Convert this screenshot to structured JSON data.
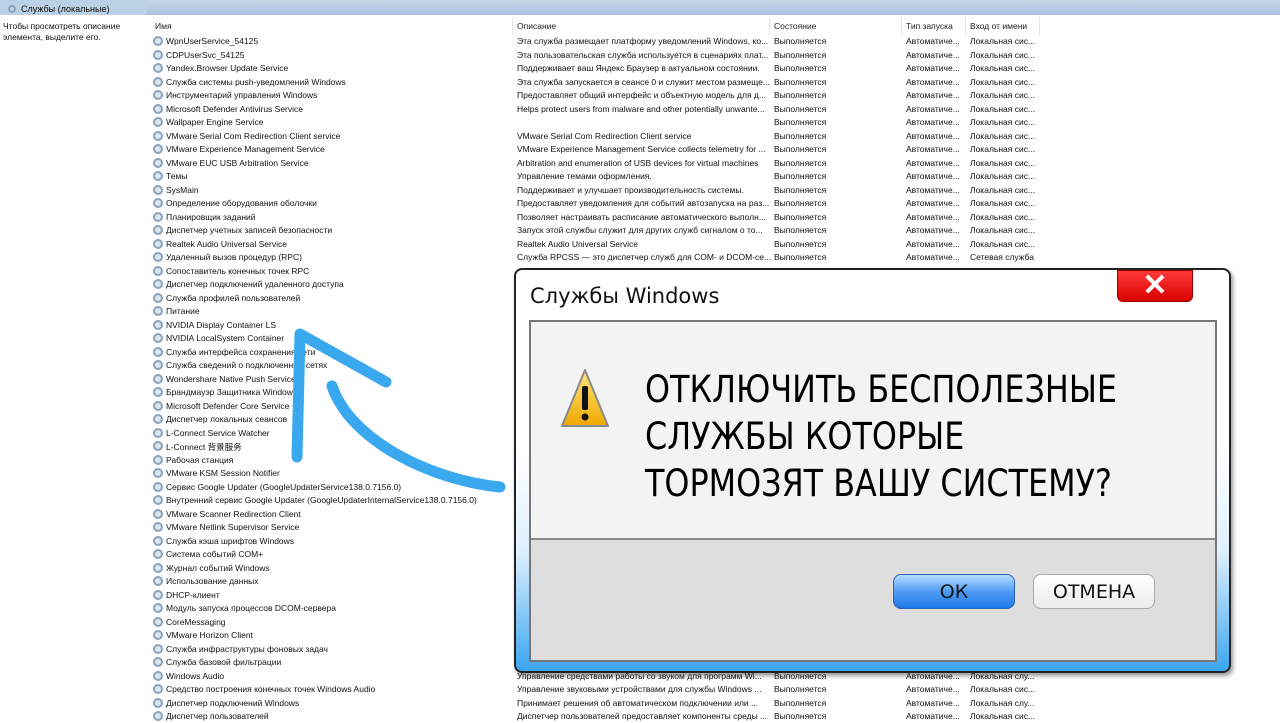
{
  "window": {
    "title": "Службы (локальные)"
  },
  "left_pane": {
    "hint": "Чтобы просмотреть описание элемента, выделите его."
  },
  "columns": {
    "name": "Имя",
    "description": "Описание",
    "state": "Состояние",
    "startup": "Тип запуска",
    "logon": "Вход от имени"
  },
  "rows": [
    {
      "name": "WpnUserService_54125",
      "desc": "Эта служба размещает платформу уведомлений Windows, ко...",
      "state": "Выполняется",
      "startup": "Автоматиче...",
      "logon": "Локальная сис..."
    },
    {
      "name": "CDPUserSvc_54125",
      "desc": "Эта пользовательская служба используется в сценариях плат...",
      "state": "Выполняется",
      "startup": "Автоматиче...",
      "logon": "Локальная сис..."
    },
    {
      "name": "Yandex.Browser Update Service",
      "desc": "Поддерживает ваш Яндекс Браузер в актуальном состоянии.",
      "state": "Выполняется",
      "startup": "Автоматиче...",
      "logon": "Локальная сис..."
    },
    {
      "name": "Служба системы push-уведомлений Windows",
      "desc": "Эта служба запускается в сеансе 0 и служит местом размеще...",
      "state": "Выполняется",
      "startup": "Автоматиче...",
      "logon": "Локальная сис..."
    },
    {
      "name": "Инструментарий управления Windows",
      "desc": "Предоставляет общий интерфейс и объектную модель для д...",
      "state": "Выполняется",
      "startup": "Автоматиче...",
      "logon": "Локальная сис..."
    },
    {
      "name": "Microsoft Defender Antivirus Service",
      "desc": "Helps protect users from malware and other potentially unwante...",
      "state": "Выполняется",
      "startup": "Автоматиче...",
      "logon": "Локальная сис..."
    },
    {
      "name": "Wallpaper Engine Service",
      "desc": "",
      "state": "Выполняется",
      "startup": "Автоматиче...",
      "logon": "Локальная сис..."
    },
    {
      "name": "VMware Serial Com Redirection Client service",
      "desc": "VMware Serial Com Redirection Client service",
      "state": "Выполняется",
      "startup": "Автоматиче...",
      "logon": "Локальная сис..."
    },
    {
      "name": "VMware Experience Management Service",
      "desc": "VMware Experience Management Service collects telemetry for ...",
      "state": "Выполняется",
      "startup": "Автоматиче...",
      "logon": "Локальная сис..."
    },
    {
      "name": "VMware EUC USB Arbitration Service",
      "desc": "Arbitration and enumeration of USB devices for virtual machines",
      "state": "Выполняется",
      "startup": "Автоматиче...",
      "logon": "Локальная сис..."
    },
    {
      "name": "Темы",
      "desc": "Управление темами оформления.",
      "state": "Выполняется",
      "startup": "Автоматиче...",
      "logon": "Локальная сис..."
    },
    {
      "name": "SysMain",
      "desc": "Поддерживает и улучшает производительность системы.",
      "state": "Выполняется",
      "startup": "Автоматиче...",
      "logon": "Локальная сис..."
    },
    {
      "name": "Определение оборудования оболочки",
      "desc": "Предоставляет уведомления для событий автозапуска на раз...",
      "state": "Выполняется",
      "startup": "Автоматиче...",
      "logon": "Локальная сис..."
    },
    {
      "name": "Планировщик заданий",
      "desc": "Позволяет настраивать расписание автоматического выполн...",
      "state": "Выполняется",
      "startup": "Автоматиче...",
      "logon": "Локальная сис..."
    },
    {
      "name": "Диспетчер учетных записей безопасности",
      "desc": "Запуск этой службы служит для других служб сигналом о то...",
      "state": "Выполняется",
      "startup": "Автоматиче...",
      "logon": "Локальная сис..."
    },
    {
      "name": "Realtek Audio Universal Service",
      "desc": "Realtek Audio Universal Service",
      "state": "Выполняется",
      "startup": "Автоматиче...",
      "logon": "Локальная сис..."
    },
    {
      "name": "Удаленный вызов процедур (RPC)",
      "desc": "Служба RPCSS — это диспетчер служб для COM- и DCOM-се...",
      "state": "Выполняется",
      "startup": "Автоматиче...",
      "logon": "Сетевая служба"
    },
    {
      "name": "Сопоставитель конечных точек RPC"
    },
    {
      "name": "Диспетчер подключений удаленного доступа"
    },
    {
      "name": "Служба профилей пользователей"
    },
    {
      "name": "Питание"
    },
    {
      "name": "NVIDIA Display Container LS"
    },
    {
      "name": "NVIDIA LocalSystem Container"
    },
    {
      "name": "Служба интерфейса сохранения сети"
    },
    {
      "name": "Служба сведений о подключенных сетях"
    },
    {
      "name": "Wondershare Native Push Service"
    },
    {
      "name": "Брандмауэр Защитника Windows"
    },
    {
      "name": "Microsoft Defender Core Service"
    },
    {
      "name": "Диспетчер локальных сеансов"
    },
    {
      "name": "L-Connect Service Watcher"
    },
    {
      "name": "L-Connect 背景服务"
    },
    {
      "name": "Рабочая станция"
    },
    {
      "name": "VMware KSM Session Notifier"
    },
    {
      "name": "Сервис Google Updater (GoogleUpdaterService138.0.7156.0)"
    },
    {
      "name": "Внутренний сервис Google Updater (GoogleUpdaterInternalService138.0.7156.0)"
    },
    {
      "name": "VMware Scanner Redirection Client"
    },
    {
      "name": "VMware Netlink Supervisor Service"
    },
    {
      "name": "Служба кэша шрифтов Windows"
    },
    {
      "name": "Система событий COM+"
    },
    {
      "name": "Журнал событий Windows"
    },
    {
      "name": "Использование данных"
    },
    {
      "name": "DHCP-клиент"
    },
    {
      "name": "Модуль запуска процессов DCOM-сервера"
    },
    {
      "name": "CoreMessaging"
    },
    {
      "name": "VMware Horizon Client"
    },
    {
      "name": "Служба инфраструктуры фоновых задач"
    },
    {
      "name": "Служба базовой фильтрации"
    },
    {
      "name": "Windows Audio",
      "desc": "Управление средствами работы со звуком для программ Wi...",
      "state": "Выполняется",
      "startup": "Автоматиче...",
      "logon": "Локальная слу..."
    },
    {
      "name": "Средство построения конечных точек Windows Audio",
      "desc": "Управление звуковыми устройствами для службы Windows ...",
      "state": "Выполняется",
      "startup": "Автоматиче...",
      "logon": "Локальная сис..."
    },
    {
      "name": "Диспетчер подключений Windows",
      "desc": "Принимает решения об автоматическом подключении или ...",
      "state": "Выполняется",
      "startup": "Автоматиче...",
      "logon": "Локальная слу..."
    },
    {
      "name": "Диспетчер пользователей",
      "desc": "Диспетчер пользователей предоставляет компоненты среды ...",
      "state": "Выполняется",
      "startup": "Автоматиче...",
      "logon": "Локальная сис..."
    }
  ],
  "dialog": {
    "title": "Службы Windows",
    "message_lines": [
      "ОТКЛЮЧИТЬ БЕСПОЛЕЗНЫЕ",
      "СЛУЖБЫ КОТОРЫЕ",
      "ТОРМОЗЯТ ВАШУ СИСТЕМУ?"
    ],
    "ok": "ОК",
    "cancel": "ОТМЕНА",
    "close_symbol": "✕"
  },
  "colors": {
    "arrow": "#3aa8ee",
    "ok_button": "#3a8df0",
    "close_button": "#e00000"
  }
}
